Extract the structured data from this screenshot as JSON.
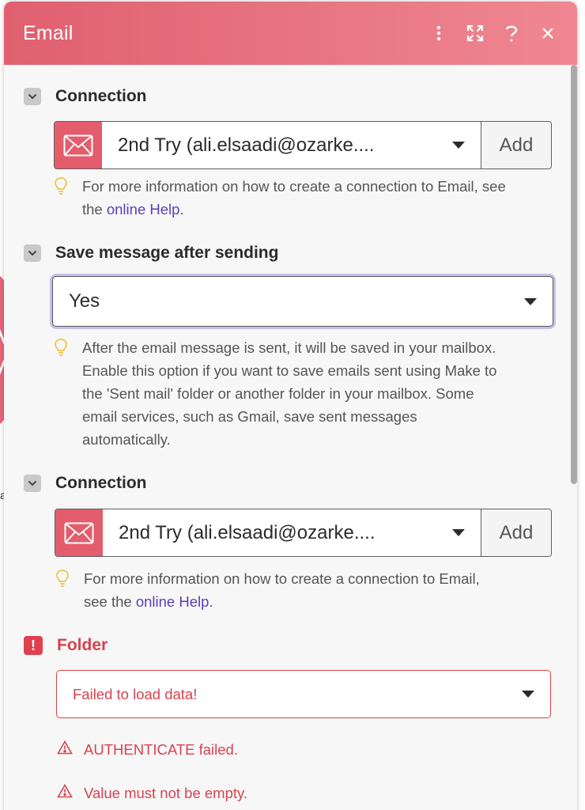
{
  "background": {
    "letter": "a"
  },
  "header": {
    "title": "Email",
    "icons": [
      "more-vertical-icon",
      "expand-icon",
      "help-icon",
      "close-icon"
    ]
  },
  "sections": {
    "connection1": {
      "label": "Connection",
      "value": "2nd Try (ali.elsaadi@ozarke....",
      "add_label": "Add",
      "hint_before": "For more information on how to create a connection to Email, see",
      "hint_mid": "the ",
      "hint_link": "online Help",
      "hint_after": "."
    },
    "save_message": {
      "label": "Save message after sending",
      "value": "Yes",
      "hint_line1": "After the email message is sent, it will be saved in your mailbox.",
      "hint_line2": "Enable this option if you want to save emails sent using Make to",
      "hint_line3": "the 'Sent mail' folder or another folder in your mailbox. Some",
      "hint_line4": "email services, such as Gmail, save sent messages",
      "hint_line5": "automatically."
    },
    "connection2": {
      "label": "Connection",
      "value": "2nd Try (ali.elsaadi@ozarke....",
      "add_label": "Add",
      "hint_line1": "For more information on how to create a connection to Email,",
      "hint_mid": "see the ",
      "hint_link": "online Help",
      "hint_after": "."
    },
    "folder": {
      "label": "Folder",
      "value": "Failed to load data!",
      "errors": [
        "AUTHENTICATE failed.",
        "Value must not be empty."
      ]
    }
  },
  "colors": {
    "header_start": "#e0606f",
    "header_end": "#ef8792",
    "error": "#d6434f",
    "link": "#5a3fb8",
    "focus_border": "#c9bfec"
  }
}
